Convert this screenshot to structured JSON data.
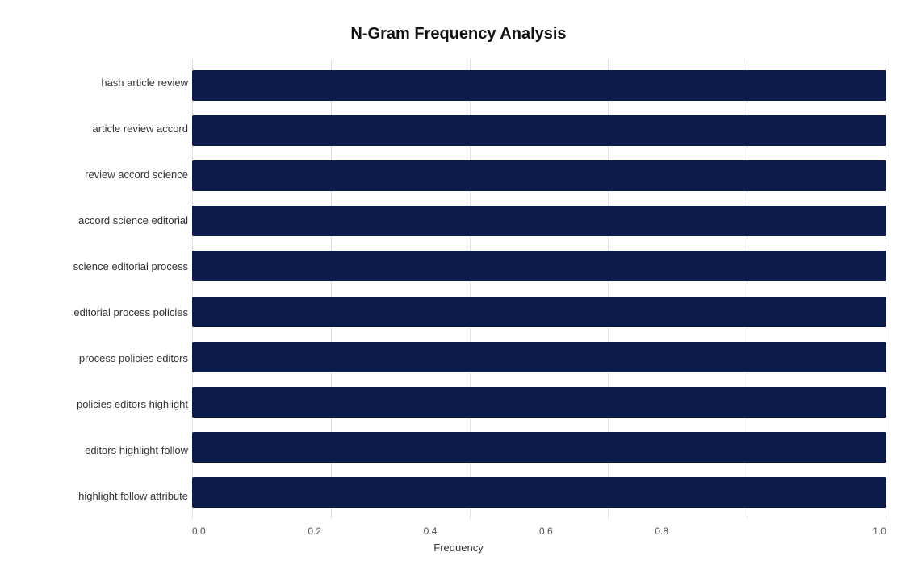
{
  "chart": {
    "title": "N-Gram Frequency Analysis",
    "x_axis_label": "Frequency",
    "x_ticks": [
      "0.0",
      "0.2",
      "0.4",
      "0.6",
      "0.8",
      "1.0"
    ],
    "bar_color": "#0d1b4b",
    "bars": [
      {
        "label": "hash article review",
        "value": 1.0
      },
      {
        "label": "article review accord",
        "value": 1.0
      },
      {
        "label": "review accord science",
        "value": 1.0
      },
      {
        "label": "accord science editorial",
        "value": 1.0
      },
      {
        "label": "science editorial process",
        "value": 1.0
      },
      {
        "label": "editorial process policies",
        "value": 1.0
      },
      {
        "label": "process policies editors",
        "value": 1.0
      },
      {
        "label": "policies editors highlight",
        "value": 1.0
      },
      {
        "label": "editors highlight follow",
        "value": 1.0
      },
      {
        "label": "highlight follow attribute",
        "value": 1.0
      }
    ]
  }
}
